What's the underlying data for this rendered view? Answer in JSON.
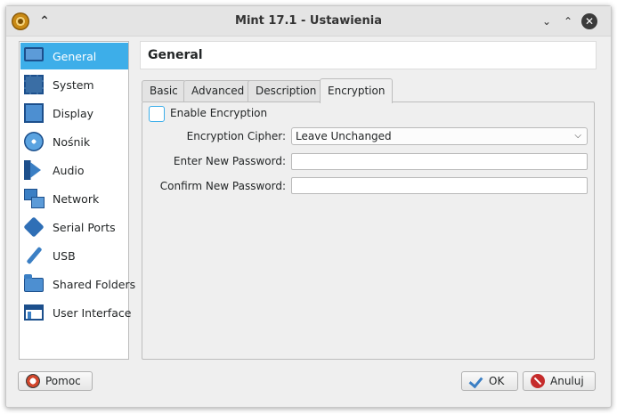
{
  "window": {
    "title": "Mint 17.1 - Ustawienia",
    "keep_above_glyph": "⌃",
    "minimize_glyph": "⌄",
    "maximize_glyph": "⌃",
    "close_glyph": "✕"
  },
  "sidebar": {
    "items": [
      {
        "label": "General",
        "icon": "monitor-icon",
        "active": true
      },
      {
        "label": "System",
        "icon": "chip-icon"
      },
      {
        "label": "Display",
        "icon": "display-icon"
      },
      {
        "label": "Nośnik",
        "icon": "disc-icon"
      },
      {
        "label": "Audio",
        "icon": "speaker-icon"
      },
      {
        "label": "Network",
        "icon": "network-icon"
      },
      {
        "label": "Serial Ports",
        "icon": "serial-port-icon"
      },
      {
        "label": "USB",
        "icon": "usb-icon"
      },
      {
        "label": "Shared Folders",
        "icon": "folder-icon"
      },
      {
        "label": "User Interface",
        "icon": "user-interface-icon"
      }
    ]
  },
  "section_title": "General",
  "tabs": [
    {
      "label": "Basic"
    },
    {
      "label": "Advanced"
    },
    {
      "label": "Description"
    },
    {
      "label": "Encryption",
      "active": true
    }
  ],
  "encryption": {
    "enable_label": "Enable Encryption",
    "enable_checked": false,
    "cipher_label": "Encryption Cipher:",
    "cipher_value": "Leave Unchanged",
    "new_password_label": "Enter New Password:",
    "new_password_value": "",
    "confirm_password_label": "Confirm New Password:",
    "confirm_password_value": ""
  },
  "footer": {
    "help_label": "Pomoc",
    "ok_label": "OK",
    "cancel_label": "Anuluj"
  },
  "colors": {
    "accent": "#3daee9",
    "window_bg": "#efefef"
  }
}
